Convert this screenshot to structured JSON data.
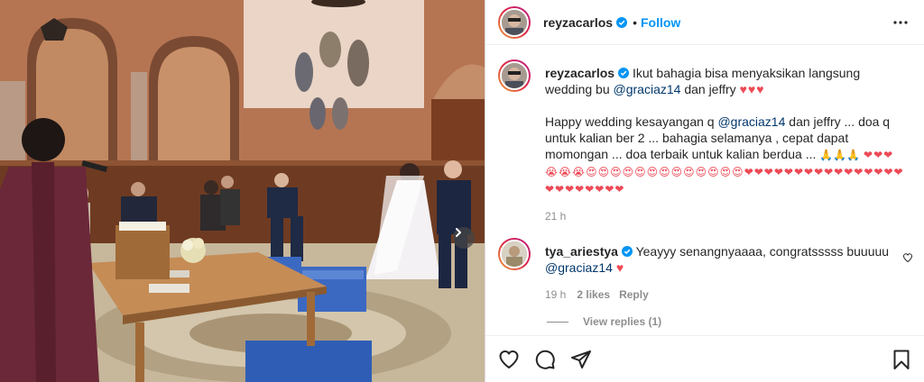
{
  "post": {
    "author": "reyzacarlos",
    "follow_label": "Follow",
    "separator": "•"
  },
  "caption": {
    "author": "reyzacarlos",
    "line1": "Ikut bahagia bisa menyaksikan langsung wedding bu",
    "mention1": "@graciaz14",
    "line1b": "dan jeffry",
    "hearts1": "♥♥♥",
    "para2a": "Happy wedding kesayangan q",
    "mention2": "@graciaz14",
    "para2b": "dan jeffry ... doa q untuk kalian ber 2 ... bahagia selamanya , cepat dapat momongan ... doa terbaik untuk kalian berdua ...",
    "emoji_praying": "🙏🙏🙏",
    "emoji_row": "❤❤❤😭😭😭😍😍😍😍😍😍😍😍😍😍😍😍😍❤❤❤❤❤❤❤❤❤❤❤❤❤❤❤❤❤❤❤❤❤❤❤❤",
    "time": "21 h"
  },
  "comment": {
    "author": "tya_ariestya",
    "text": "Yeayyy senangnyaaaa, congratsssss buuuuu",
    "mention": "@graciaz14",
    "heart": "♥",
    "time": "19 h",
    "likes": "2 likes",
    "reply": "Reply",
    "view_replies": "View replies (1)"
  },
  "colors": {
    "accent": "#0095f6",
    "heart": "#ed4956",
    "muted": "#8e8e8e",
    "mention": "#00376b"
  },
  "icons": [
    "verified-badge-icon",
    "more-options-icon",
    "heart-icon",
    "comment-icon",
    "share-icon",
    "bookmark-icon",
    "next-arrow-icon"
  ]
}
